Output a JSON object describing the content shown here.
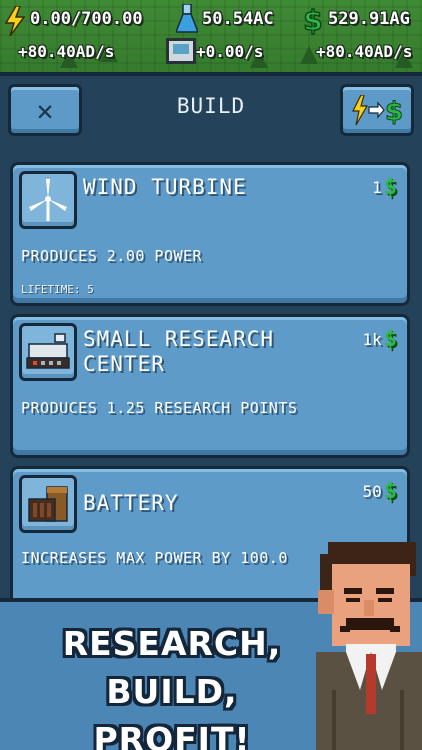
{
  "hud": {
    "power": "0.00/700.00",
    "power_rate": "+80.40AD/s",
    "research": "50.54AC",
    "research_rate": "+0.00/s",
    "money": "529.91AG",
    "money_rate": "+80.40AD/s"
  },
  "dialog": {
    "title": "BUILD",
    "close_icon": "close-icon",
    "sell_icon": "power-to-money-icon"
  },
  "items": [
    {
      "name": "WIND TURBINE",
      "price": "1",
      "description": "PRODUCES 2.00 POWER",
      "lifetime": "LIFETIME: 5",
      "icon": "wind-turbine-icon"
    },
    {
      "name_line1": "SMALL RESEARCH",
      "name_line2": "CENTER",
      "price": "1k",
      "description": "PRODUCES 1.25 RESEARCH POINTS",
      "icon": "research-center-icon"
    },
    {
      "name": "BATTERY",
      "price": "50",
      "description": "INCREASES MAX POWER BY 100.0",
      "icon": "battery-icon"
    }
  ],
  "currency_symbol": "$",
  "promo": {
    "line1": "RESEARCH,",
    "line2": "BUILD, PROFIT!"
  },
  "colors": {
    "card": "#5f9bc9",
    "dialog_bg": "#24435b",
    "money_green": "#2fb84a",
    "power_yellow": "#f7d21c"
  }
}
